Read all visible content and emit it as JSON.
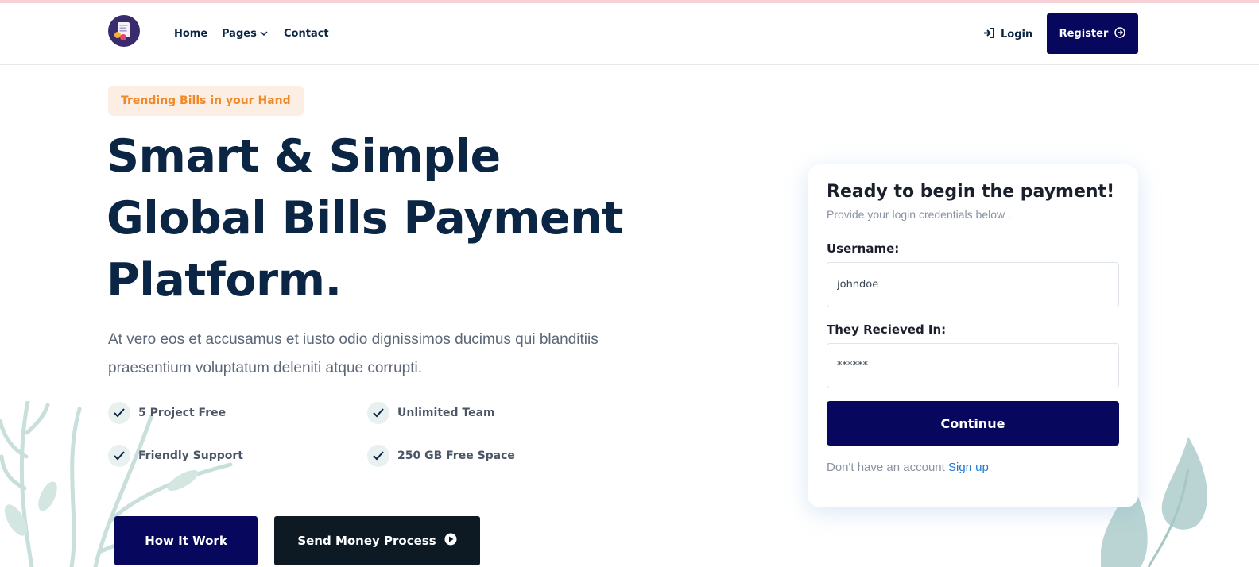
{
  "nav": {
    "home": "Home",
    "pages": "Pages",
    "contact": "Contact",
    "login": "Login",
    "register": "Register"
  },
  "hero": {
    "badge": "Trending Bills in your Hand",
    "title_line1": "Smart & Simple",
    "title_line2": "Global Bills Payment",
    "title_line3": "Platform.",
    "description": "At vero eos et accusamus et iusto odio dignissimos ducimus qui blanditiis praesentium voluptatum deleniti atque corrupti.",
    "features": [
      "5 Project Free",
      "Unlimited Team",
      "Friendly Support",
      "250 GB Free Space"
    ],
    "btn_how": "How It Work",
    "btn_send": "Send Money Process"
  },
  "login_card": {
    "title": "Ready to begin the payment!",
    "subtitle": "Provide your login credentials below .",
    "username_label": "Username:",
    "username_value": "johndoe",
    "password_label": "They Recieved In:",
    "password_value": "******",
    "continue": "Continue",
    "no_account": "Don't have an account",
    "signup": "Sign up"
  },
  "icons": {
    "logo": "bill-logo-icon",
    "chevron": "chevron-down-icon",
    "login": "sign-in-icon",
    "register": "arrow-circle-right-icon",
    "check": "check-icon",
    "play": "play-circle-icon"
  },
  "colors": {
    "brand_navy": "#07075e",
    "dark_button": "#0d1a24",
    "heading": "#0b2545",
    "badge_bg": "#fdeee4",
    "badge_text": "#ee8a2c",
    "link_blue": "#1f7ad6",
    "plant": "#bcd8d3"
  }
}
